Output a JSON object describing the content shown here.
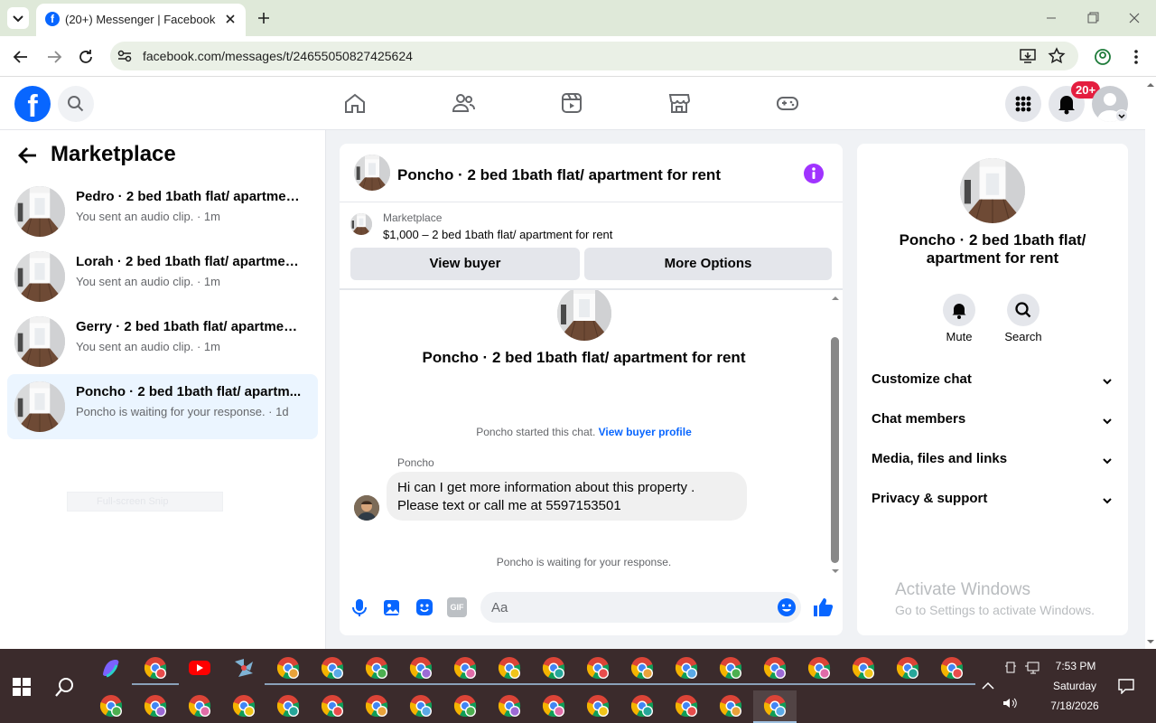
{
  "browser": {
    "tab_title": "(20+) Messenger | Facebook",
    "url": "facebook.com/messages/t/24655050827425624"
  },
  "header": {
    "notifications_badge": "20+"
  },
  "left_panel": {
    "title": "Marketplace",
    "conversations": [
      {
        "title": "Pedro · 2 bed 1bath flat/ apartmen...",
        "subtitle": "You sent an audio clip. · 1m"
      },
      {
        "title": "Lorah · 2 bed 1bath flat/ apartmen...",
        "subtitle": "You sent an audio clip. · 1m"
      },
      {
        "title": "Gerry · 2 bed 1bath flat/ apartmen...",
        "subtitle": "You sent an audio clip. · 1m"
      },
      {
        "title": "Poncho · 2 bed 1bath flat/ apartm...",
        "subtitle": "Poncho is waiting for your response. · 1d"
      }
    ],
    "snip_overlay": "Full-screen Snip"
  },
  "chat": {
    "header_title": "Poncho · 2 bed 1bath flat/ apartment for rent",
    "listing_source": "Marketplace",
    "listing_detail": "$1,000 – 2 bed 1bath flat/ apartment for rent",
    "view_buyer_label": "View buyer",
    "more_options_label": "More Options",
    "intro_title": "Poncho · 2 bed 1bath flat/ apartment for rent",
    "started_text": "Poncho started this chat.",
    "view_profile_link": "View buyer profile",
    "sender_name": "Poncho",
    "message_line1": "Hi can I get more information about this property .",
    "message_line2": "Please text or call me at 5597153501",
    "waiting_text": "Poncho is waiting for your response.",
    "composer_placeholder": "Aa"
  },
  "info_panel": {
    "title": "Poncho · 2 bed 1bath flat/ apartment for rent",
    "mute_label": "Mute",
    "search_label": "Search",
    "sections": [
      "Customize chat",
      "Chat members",
      "Media, files and links",
      "Privacy & support"
    ],
    "watermark_line1": "Activate Windows",
    "watermark_line2": "Go to Settings to activate Windows."
  },
  "taskbar": {
    "time": "7:53 PM",
    "day": "Saturday",
    "date": "7/18/2026"
  },
  "colors": {
    "fb_blue": "#0866ff",
    "accent_purple": "#a033ff",
    "tab_bar": "#dfe9d9",
    "taskbar": "#3b2b2c"
  }
}
